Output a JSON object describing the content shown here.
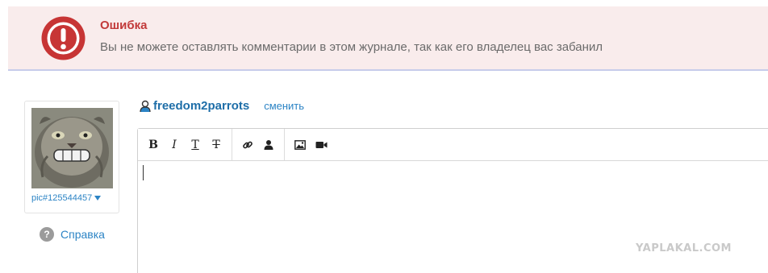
{
  "error": {
    "title": "Ошибка",
    "message": "Вы не можете оставлять комментарии в этом журнале, так как его владелец вас забанил",
    "icon": "exclamation-icon",
    "color": "#c23a3a"
  },
  "sidebar": {
    "userpic_label": "pic#125544457",
    "help_label": "Справка",
    "help_icon_glyph": "?"
  },
  "author": {
    "username": "freedom2parrots",
    "change_label": "сменить"
  },
  "toolbar": {
    "bold": "B",
    "italic": "I",
    "underline": "T",
    "strikethrough": "T"
  },
  "watermark": "YAPLAKAL.COM",
  "colors": {
    "banner_bg": "#f9ecec",
    "link": "#2c84c5",
    "username": "#1e6ea8"
  }
}
